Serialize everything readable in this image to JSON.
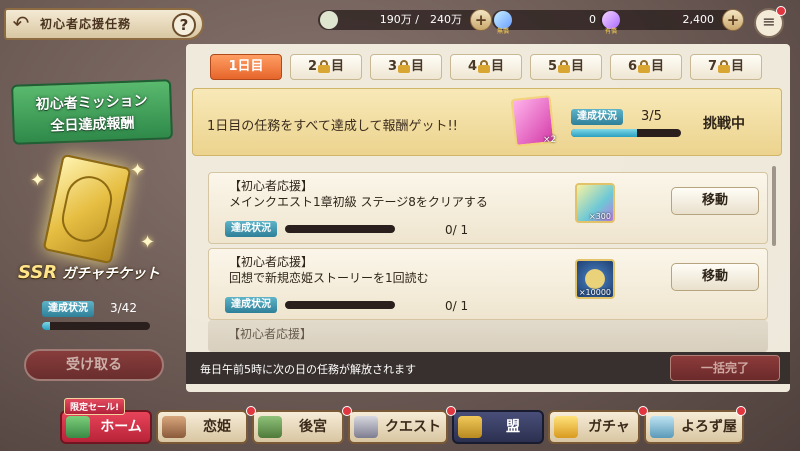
{
  "header": {
    "title": "初心者応援任務",
    "back_icon": "↶",
    "help_label": "?",
    "stamina": "190万 /　240万",
    "gem_free_label": "無償",
    "gem_free": "0",
    "gem_paid_label": "有償",
    "gem_paid": "2,400",
    "plus_label": "+",
    "menu_icon": "≡",
    "icon_names": [
      "back-arrow-icon",
      "help-icon",
      "rice-ball-icon",
      "gem-icon",
      "menu-icon"
    ]
  },
  "left": {
    "banner_line1": "初心者ミッション",
    "banner_line2": "全日達成報酬",
    "ssr": "SSR",
    "reward_name": "ガチャチケット",
    "progress_label": "達成状況",
    "progress_count": "3/42",
    "progress_fraction": 0.07,
    "receive_label": "受け取る"
  },
  "tabs": [
    {
      "prefix": "1日目",
      "suffix": "",
      "locked": false,
      "active": true
    },
    {
      "prefix": "2",
      "suffix": "目",
      "locked": true,
      "active": false
    },
    {
      "prefix": "3",
      "suffix": "目",
      "locked": true,
      "active": false
    },
    {
      "prefix": "4",
      "suffix": "目",
      "locked": true,
      "active": false
    },
    {
      "prefix": "5",
      "suffix": "目",
      "locked": true,
      "active": false
    },
    {
      "prefix": "6",
      "suffix": "目",
      "locked": true,
      "active": false
    },
    {
      "prefix": "7",
      "suffix": "目",
      "locked": true,
      "active": false
    }
  ],
  "summary": {
    "text": "1日目の任務をすべて達成して報酬ゲット!!",
    "reward_badge": "×2",
    "progress_label": "達成状況",
    "progress_count": "3/5",
    "progress_fraction": 0.6,
    "status": "挑戦中"
  },
  "missions": [
    {
      "category": "【初心者応援】",
      "description": "メインクエスト1章初級 ステージ8をクリアする",
      "progress_label": "達成状況",
      "count": "0/ 1",
      "progress_fraction": 0.0,
      "reward_amount": "×300",
      "reward_icon": "gem-pouch-icon",
      "button": "移動"
    },
    {
      "category": "【初心者応援】",
      "description": "回想で新規恋姫ストーリーを1回読む",
      "progress_label": "達成状況",
      "count": "0/ 1",
      "progress_fraction": 0.0,
      "reward_amount": "×10000",
      "reward_icon": "coin-icon",
      "button": "移動"
    }
  ],
  "partial_mission": {
    "category": "【初心者応援】"
  },
  "footer": {
    "note": "毎日午前5時に次の日の任務が解放されます",
    "bulk_label": "一括完了"
  },
  "nav": {
    "sale_tag": "限定セール!",
    "items": [
      {
        "label": "ホーム",
        "icon": "book-icon"
      },
      {
        "label": "恋姫",
        "icon": "girl-icon"
      },
      {
        "label": "後宮",
        "icon": "palace-icon"
      },
      {
        "label": "クエスト",
        "icon": "swords-icon"
      },
      {
        "label": "盟",
        "icon": "lock-icon"
      },
      {
        "label": "ガチャ",
        "icon": "gacha-icon"
      },
      {
        "label": "よろず屋",
        "icon": "bag-icon"
      }
    ]
  },
  "colors": {
    "accent_orange": "#e6652b",
    "progress_teal": "#2aa0bf",
    "panel_cream": "#f5efe2",
    "banner_green": "#2f8a4a",
    "home_red": "#b82338"
  }
}
